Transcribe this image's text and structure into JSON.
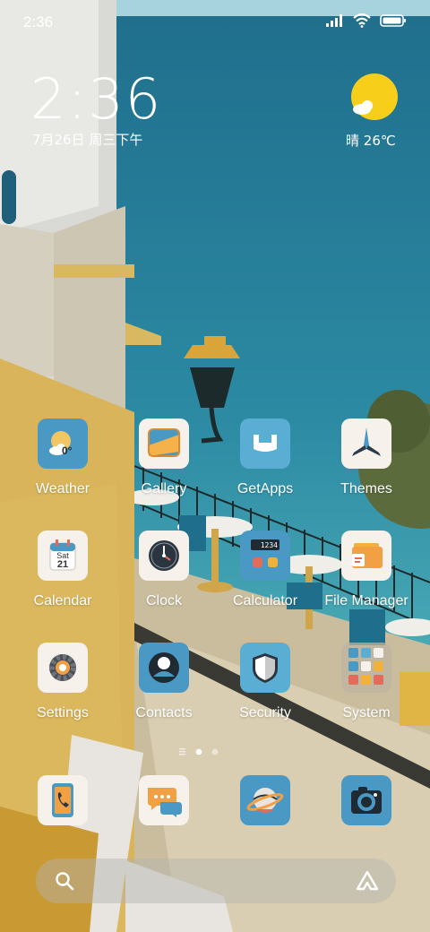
{
  "status_bar": {
    "time": "2:36",
    "icons": [
      "signal-icon",
      "wifi-icon",
      "battery-icon"
    ]
  },
  "clock_widget": {
    "time": "2:36",
    "date": "7月26日 周三下午"
  },
  "weather_widget": {
    "condition": "晴",
    "temperature": "26℃",
    "icon": "sun-icon"
  },
  "apps": [
    {
      "label": "Weather",
      "icon": "weather-icon",
      "badge": "0°"
    },
    {
      "label": "Gallery",
      "icon": "gallery-icon"
    },
    {
      "label": "GetApps",
      "icon": "getapps-icon"
    },
    {
      "label": "Themes",
      "icon": "themes-icon"
    },
    {
      "label": "Calendar",
      "icon": "calendar-icon",
      "day": "Sat",
      "date": "21"
    },
    {
      "label": "Clock",
      "icon": "clock-icon"
    },
    {
      "label": "Calculator",
      "icon": "calculator-icon",
      "display": "1234"
    },
    {
      "label": "File Manager",
      "icon": "file-manager-icon"
    },
    {
      "label": "Settings",
      "icon": "settings-icon"
    },
    {
      "label": "Contacts",
      "icon": "contacts-icon"
    },
    {
      "label": "Security",
      "icon": "security-icon"
    },
    {
      "label": "System",
      "icon": "folder-icon"
    }
  ],
  "page_indicator": {
    "pages": 2,
    "current": 1
  },
  "dock": [
    {
      "icon": "phone-icon"
    },
    {
      "icon": "messages-icon"
    },
    {
      "icon": "browser-icon"
    },
    {
      "icon": "camera-icon"
    }
  ],
  "search": {
    "left_icon": "search-icon",
    "right_icon": "assistant-icon"
  },
  "colors": {
    "sky": "#2c87a3",
    "tile_light": "#f6f1ea",
    "tile_blue": "#4a99c4",
    "sun": "#f7cf1a"
  }
}
